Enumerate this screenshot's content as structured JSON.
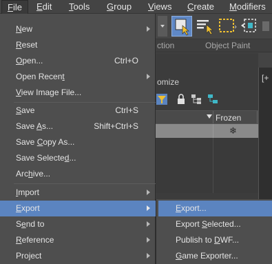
{
  "menubar": {
    "items": [
      {
        "label": "File",
        "mnemonic": "F",
        "rest": "ile"
      },
      {
        "label": "Edit",
        "mnemonic": "E",
        "rest": "dit"
      },
      {
        "label": "Tools",
        "mnemonic": "T",
        "rest": "ools"
      },
      {
        "label": "Group",
        "mnemonic": "G",
        "rest": "roup"
      },
      {
        "label": "Views",
        "mnemonic": "V",
        "rest": "iews"
      },
      {
        "label": "Create",
        "mnemonic": "C",
        "rest": "reate"
      },
      {
        "label": "Modifiers",
        "mnemonic": "M",
        "rest": "odifiers"
      }
    ]
  },
  "file_menu": {
    "items": [
      {
        "pre": "",
        "mnemonic": "N",
        "post": "ew",
        "shortcut": "",
        "submenu": true
      },
      {
        "pre": "",
        "mnemonic": "R",
        "post": "eset",
        "shortcut": "",
        "submenu": false
      },
      {
        "pre": "",
        "mnemonic": "O",
        "post": "pen...",
        "shortcut": "Ctrl+O",
        "submenu": false
      },
      {
        "pre": "Open Recen",
        "mnemonic": "t",
        "post": "",
        "shortcut": "",
        "submenu": true
      },
      {
        "pre": "",
        "mnemonic": "V",
        "post": "iew Image File...",
        "shortcut": "",
        "submenu": false
      },
      {
        "pre": "",
        "mnemonic": "S",
        "post": "ave",
        "shortcut": "Ctrl+S",
        "submenu": false
      },
      {
        "pre": "Save ",
        "mnemonic": "A",
        "post": "s...",
        "shortcut": "Shift+Ctrl+S",
        "submenu": false
      },
      {
        "pre": "Save ",
        "mnemonic": "C",
        "post": "opy As...",
        "shortcut": "",
        "submenu": false
      },
      {
        "pre": "Save Selecte",
        "mnemonic": "d",
        "post": "...",
        "shortcut": "",
        "submenu": false
      },
      {
        "pre": "Arc",
        "mnemonic": "h",
        "post": "ive...",
        "shortcut": "",
        "submenu": false
      },
      {
        "pre": "",
        "mnemonic": "I",
        "post": "mport",
        "shortcut": "",
        "submenu": true
      },
      {
        "pre": "",
        "mnemonic": "E",
        "post": "xport",
        "shortcut": "",
        "submenu": true
      },
      {
        "pre": "S",
        "mnemonic": "e",
        "post": "nd to",
        "shortcut": "",
        "submenu": true
      },
      {
        "pre": "",
        "mnemonic": "R",
        "post": "eference",
        "shortcut": "",
        "submenu": true
      },
      {
        "pre": "Pro",
        "mnemonic": "j",
        "post": "ect",
        "shortcut": "",
        "submenu": true
      }
    ],
    "highlighted": "Export"
  },
  "export_submenu": {
    "items": [
      {
        "pre": "",
        "mnemonic": "E",
        "post": "xport..."
      },
      {
        "pre": "Export ",
        "mnemonic": "S",
        "post": "elected..."
      },
      {
        "pre": "Publish to ",
        "mnemonic": "D",
        "post": "WF..."
      },
      {
        "pre": "",
        "mnemonic": "G",
        "post": "ame Exporter..."
      }
    ],
    "highlighted": "Export..."
  },
  "background": {
    "ribbon_label_left": "ction",
    "ribbon_label_right": "Object Paint",
    "panel_title": "omize",
    "column_header": "Frozen",
    "viewport_label": "[+"
  },
  "colors": {
    "highlight": "#5b84c0",
    "menu_bg": "#4e4e4e",
    "app_bg": "#444444"
  }
}
